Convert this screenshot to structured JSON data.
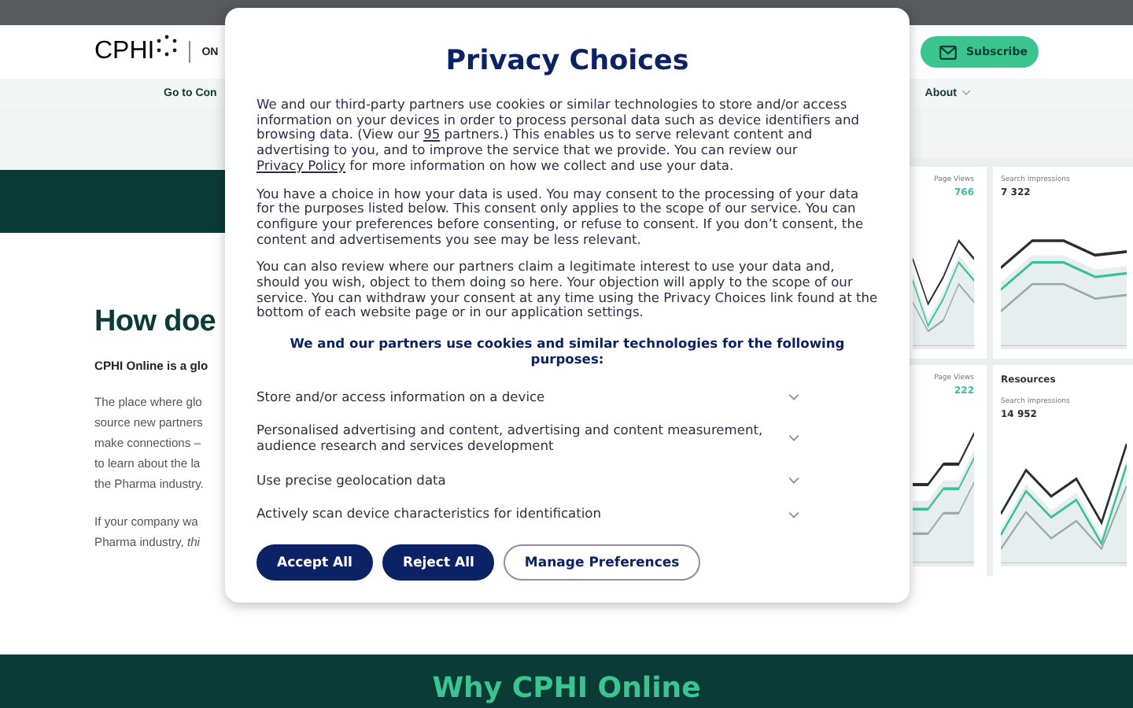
{
  "top_bar": {
    "logo": "CPHI",
    "product": "ON",
    "subscribe": "Subscribe"
  },
  "nav": {
    "left": "Go to Con",
    "right": "About"
  },
  "heading": "How doe",
  "intro": "CPHI Online is a glo",
  "paragraphs": [
    [
      "The place where glo",
      "source new partners",
      "make connections –",
      "to learn about the la",
      "the Pharma industry."
    ],
    [
      "If your company wa",
      "Pharma industry, *thi*"
    ]
  ],
  "footer_heading": "Why CPHI Online",
  "dashboard": {
    "cards": [
      {
        "title": "Page Views",
        "value": "766",
        "color": "#3bbf96"
      },
      {
        "title": "Search impressions",
        "value": "7 322",
        "color": "#2a2f2e"
      },
      {
        "title": "Page Views",
        "value": "222",
        "color": "#3bbf96"
      },
      {
        "heading": "Resources",
        "title": "Search impressions",
        "value": "14 952",
        "color": "#2a2f2e"
      }
    ]
  },
  "modal": {
    "title": "Privacy Choices",
    "paragraphs": [
      [
        {
          "kind": "text",
          "text": "We and our third-party partners use cookies or similar technologies to store and/or access information on your devices in order to process personal data such as device identifiers and browsing data. (View our "
        },
        {
          "kind": "link",
          "text": "95"
        },
        {
          "kind": "text",
          "text": " partners.) This enables us to serve relevant content and advertising to you, and to improve the service that we provide. You can review our "
        },
        {
          "kind": "link",
          "text": "Privacy Policy"
        },
        {
          "kind": "text",
          "text": " for more information on how we collect and use your data."
        }
      ],
      [
        {
          "kind": "text",
          "text": "You have a choice in how your data is used. You may consent to the processing of your data for the purposes listed below. This consent only applies to the scope of our service. You can configure your preferences before consenting, or refuse to consent. If you don’t consent, the content and advertisements you see may be less relevant."
        }
      ],
      [
        {
          "kind": "text",
          "text": "You can also review where our partners claim a legitimate interest to use your data and, should you wish, object to them doing so here. Your objection will apply to the scope of our service. You can withdraw your consent at any time using the Privacy Choices link found at the bottom of each website page or in our application settings."
        }
      ]
    ],
    "purposes_heading": "We and our partners use cookies and similar technologies for the following purposes:",
    "purposes": [
      {
        "label": "Store and/or access information on a device",
        "expanded": false
      },
      {
        "label": "Personalised advertising and content, advertising and content measurement, audience research and services development",
        "expanded": false
      },
      {
        "label": "Use precise geolocation data",
        "expanded": false
      },
      {
        "label": "Actively scan device characteristics for identification",
        "expanded": false
      }
    ],
    "buttons": [
      {
        "label": "Accept All",
        "kind": "primary"
      },
      {
        "label": "Reject All",
        "kind": "primary"
      },
      {
        "label": "Manage Preferences",
        "kind": "secondary"
      }
    ]
  }
}
